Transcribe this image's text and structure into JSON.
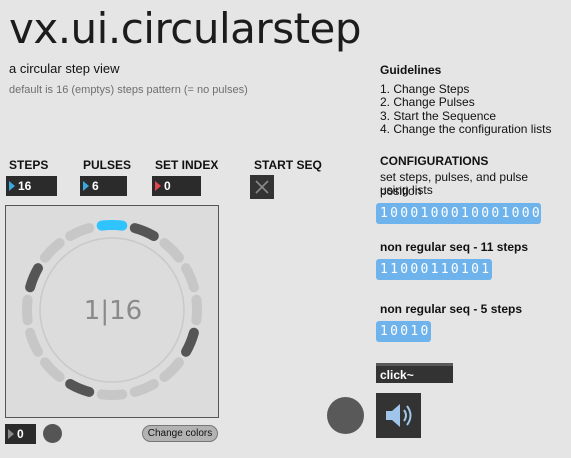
{
  "header": {
    "title": "vx.ui.circularstep",
    "subtitle": "a circular step view",
    "default_note": "default is 16 (emptys) steps pattern (= no pulses)"
  },
  "guidelines": {
    "heading": "Guidelines",
    "items": [
      "1. Change Steps",
      "2. Change Pulses",
      "3. Start the Sequence",
      "4. Change the configuration lists"
    ]
  },
  "controls": {
    "steps_label": "STEPS",
    "steps_value": "16",
    "pulses_label": "PULSES",
    "pulses_value": "6",
    "set_index_label": "SET INDEX",
    "set_index_value": "0",
    "start_seq_label": "START SEQ",
    "start_seq_on": false
  },
  "circular_view": {
    "readout": "1|16",
    "total_steps": 16,
    "pulse_steps": [
      1,
      5,
      9,
      13
    ],
    "current_step": 0,
    "colors": {
      "active": "#2fc3ff",
      "pulse": "#555555",
      "empty": "#c7c7c7",
      "panel": "#dcdcdc"
    }
  },
  "configurations": {
    "heading": "CONFIGURATIONS",
    "description_line1": "set steps, pulses, and pulse position",
    "description_line2": "using lists",
    "list1": "1000100010001000",
    "nonreg11_label": "non regular seq - 11 steps",
    "list2": "11000110101",
    "nonreg5_label": "non regular seq - 5 steps",
    "list3": "10010"
  },
  "bottom": {
    "click_label": "click~",
    "number_value": "0",
    "change_colors_label": "Change colors",
    "speaker_icon": "speaker-icon"
  }
}
